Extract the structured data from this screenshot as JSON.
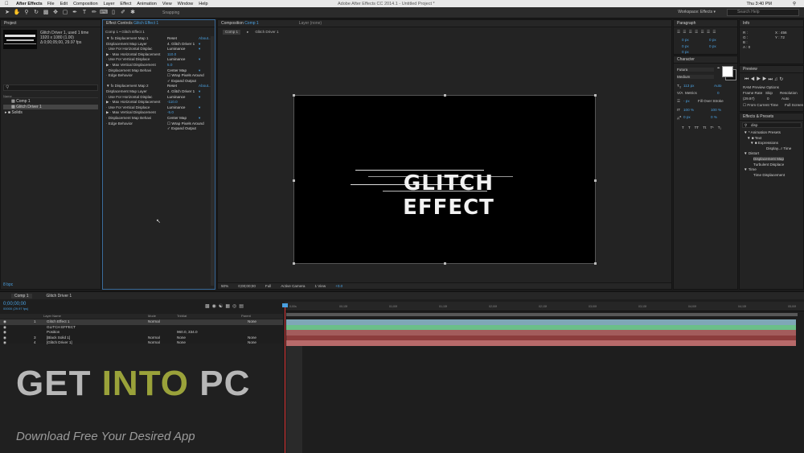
{
  "menubar": {
    "app": "After Effects",
    "items": [
      "File",
      "Edit",
      "Composition",
      "Layer",
      "Effect",
      "Animation",
      "View",
      "Window",
      "Help"
    ],
    "window_title": "Adobe After Effects CC 2014.1 - Untitled Project *",
    "clock": "Thu 3:40 PM"
  },
  "toolbar": {
    "snapping": "Snapping",
    "workspace_label": "Workspace:",
    "workspace_value": "Effects",
    "search_placeholder": "Search Help"
  },
  "project": {
    "tab": "Project",
    "info_name": "Glitch Driver 1",
    "info_used": ", used 1 time",
    "info_size": "1920 x 1080 (1.00)",
    "info_duration": "Δ 0;00;05;00, 29.97 fps",
    "search_icon": "magnifier-icon",
    "col_name": "Name",
    "items": [
      "Comp 1",
      "Glitch Driver 1",
      "Solids"
    ],
    "footer": "8 bpc"
  },
  "effect_controls": {
    "tab": "Effect Controls",
    "tab_layer": "Glitch Effect 1",
    "header": "Comp 1 • Glitch Effect 1",
    "rows": [
      {
        "label": "▼ fx  Displacement Map 1",
        "val": "Reset",
        "rt": "About..."
      },
      {
        "label": "     Displacement Map Layer",
        "val": "4. Glitch Driver 1",
        "rt": "▾"
      },
      {
        "label": "     · Use For Horizontal Displac",
        "val": "Luminance",
        "rt": "▾"
      },
      {
        "label": "   ▶ · Max Horizontal Displacement",
        "val": "110.0",
        "blue": true
      },
      {
        "label": "     · Use For Vertical Displace",
        "val": "Luminance",
        "rt": "▾"
      },
      {
        "label": "   ▶ · Max Vertical Displacement",
        "val": "5.0",
        "blue": true
      },
      {
        "label": "     · Displacement Map Behavi",
        "val": "Center Map",
        "rt": "▾"
      },
      {
        "label": "     · Edge Behavior",
        "val": "☐ Wrap Pixels Around"
      },
      {
        "label": "",
        "val": "✓ Expand Output"
      },
      {
        "label": "▼ fx  Displacement Map 2",
        "val": "Reset",
        "rt": "About..."
      },
      {
        "label": "     Displacement Map Layer",
        "val": "4. Glitch Driver 1",
        "rt": "▾"
      },
      {
        "label": "     · Use For Horizontal Displac",
        "val": "Luminance",
        "rt": "▾"
      },
      {
        "label": "   ▶ · Max Horizontal Displacement",
        "val": "-110.0",
        "blue": true
      },
      {
        "label": "     · Use For Vertical Displace",
        "val": "Luminance",
        "rt": "▾"
      },
      {
        "label": "   ▶ · Max Vertical Displacement",
        "val": "-5.0",
        "blue": true
      },
      {
        "label": "     · Displacement Map Behavi",
        "val": "Center Map",
        "rt": "▾"
      },
      {
        "label": "     · Edge Behavior",
        "val": "☐ Wrap Pixels Around"
      },
      {
        "label": "",
        "val": "✓ Expand Output"
      }
    ]
  },
  "composition": {
    "tab_label": "Composition",
    "tab_comp": "Comp 1",
    "layer_label": "Layer (none)",
    "breadcrumb_comp": "Comp 1",
    "breadcrumb_layer": "Glitch Driver 1",
    "canvas_text": "GLITCH EFFECT",
    "footer": [
      "50%",
      "0;00;00;00",
      "Full",
      "Active Camera",
      "1 View",
      "+0.0"
    ]
  },
  "paragraph": {
    "tab": "Paragraph",
    "values": [
      "0 px",
      "0 px",
      "0 px",
      "0 px",
      "0 px"
    ]
  },
  "info": {
    "tab": "Info",
    "r": "R :",
    "g": "G :",
    "b": "B :",
    "a": "A : 0",
    "x": "X : 456",
    "y": "Y : 72"
  },
  "character": {
    "tab": "Character",
    "font": "Futura",
    "style": "Medium",
    "size": "113 px",
    "leading": "Auto",
    "kerning": "Metrics",
    "tracking": "0",
    "stroke": "- px",
    "stroke_mode": "Fill Over Stroke",
    "scale_v": "100 %",
    "scale_h": "100 %",
    "baseline": "0 px",
    "tsume": "0 %",
    "styles": [
      "T",
      "T",
      "TT",
      "Tt",
      "T¹",
      "T₁"
    ]
  },
  "preview": {
    "tab": "Preview",
    "ram": "RAM Preview Options",
    "frame_rate": "Frame Rate",
    "skip": "Skip",
    "resolution": "Resolution",
    "fps": "(29.97)",
    "skip_val": "0",
    "res_val": "Auto",
    "from_current": "From Current Time",
    "full_screen": "Full Screen"
  },
  "effects_presets": {
    "tab": "Effects & Presets",
    "search": "disp",
    "items": [
      {
        "t": "▼ * Animation Presets",
        "x": 2
      },
      {
        "t": "▼ ■ Text",
        "x": 6
      },
      {
        "t": "▼ ■ Expressions",
        "x": 10
      },
      {
        "t": "Display...r Time",
        "x": 30
      },
      {
        "t": "▼ Distort",
        "x": 2
      },
      {
        "t": "Displacement Map",
        "x": 14,
        "sel": true
      },
      {
        "t": "Turbulent Displace",
        "x": 14
      },
      {
        "t": "▼ Time",
        "x": 2
      },
      {
        "t": "Time Displacement",
        "x": 14
      }
    ]
  },
  "timeline": {
    "tabs": [
      "Comp 1",
      "Glitch Driver 1"
    ],
    "time": "0;00;00;00",
    "sub": "00000 (29.97 fps)",
    "col_layer": "Layer Name",
    "col_mode": "Mode",
    "col_trkmat": "TrkMat",
    "col_parent": "Parent",
    "layers": [
      {
        "num": "1",
        "name": "Glitch Effect 1",
        "mode": "Normal",
        "trk": "",
        "parent": "None",
        "sel": true
      },
      {
        "num": "",
        "name": "GLITCH EFFECT",
        "mode": "",
        "trk": "",
        "parent": "",
        "sel": false
      },
      {
        "num": "",
        "name": "Position",
        "mode": "",
        "trk": "960.0, 334.0",
        "parent": "",
        "sel": false
      },
      {
        "num": "3",
        "name": "[Black Solid 1]",
        "mode": "Normal",
        "trk": "None",
        "parent": "None",
        "sel": false
      },
      {
        "num": "4",
        "name": "[Glitch Driver 1]",
        "mode": "Normal",
        "trk": "None",
        "parent": "None",
        "sel": false
      }
    ],
    "ticks": [
      "0;00s",
      "00;15f",
      "01;00f",
      "01;15f",
      "02;00f",
      "02;15f",
      "03;00f",
      "03;15f",
      "04;00f",
      "04;15f",
      "05;00f"
    ],
    "bar_colors": [
      "#7fa7b7",
      "#6bbf88",
      "#a35c5c",
      "#8c3d3d",
      "#b86a6a"
    ]
  },
  "watermark": {
    "part1": "GET",
    "part2": "INTO",
    "part3": "PC",
    "sub": "Download Free Your Desired App"
  }
}
